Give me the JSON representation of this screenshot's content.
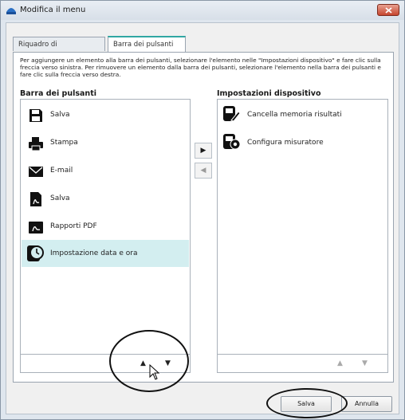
{
  "window": {
    "title": "Modifica il menu"
  },
  "tabs": [
    {
      "label": "Riquadro di navigazione"
    },
    {
      "label": "Barra dei pulsanti"
    }
  ],
  "instructions": "Per aggiungere un elemento alla barra dei pulsanti, selezionare l'elemento nelle \"Impostazioni dispositivo\" e fare clic sulla freccia verso sinistra. Per rimuovere un elemento dalla barra dei pulsanti, selezionare l'elemento nella barra dei pulsanti e fare clic sulla freccia verso destra.",
  "left_list": {
    "title": "Barra dei pulsanti",
    "items": [
      {
        "label": "Salva",
        "icon": "save-icon"
      },
      {
        "label": "Stampa",
        "icon": "printer-icon"
      },
      {
        "label": "E-mail",
        "icon": "envelope-icon"
      },
      {
        "label": "Salva",
        "icon": "pdf-save-icon"
      },
      {
        "label": "Rapporti PDF",
        "icon": "pdf-report-icon"
      },
      {
        "label": "Impostazione data e ora",
        "icon": "clock-meter-icon",
        "selected": true
      }
    ]
  },
  "right_list": {
    "title": "Impostazioni dispositivo",
    "items": [
      {
        "label": "Cancella memoria risultati",
        "icon": "erase-meter-icon"
      },
      {
        "label": "Configura misuratore",
        "icon": "gear-meter-icon"
      }
    ]
  },
  "buttons": {
    "save": "Salva",
    "cancel": "Annulla"
  },
  "colors": {
    "accent": "#30a7a3",
    "selected_row": "#d3eef0",
    "close": "#c6452e"
  }
}
